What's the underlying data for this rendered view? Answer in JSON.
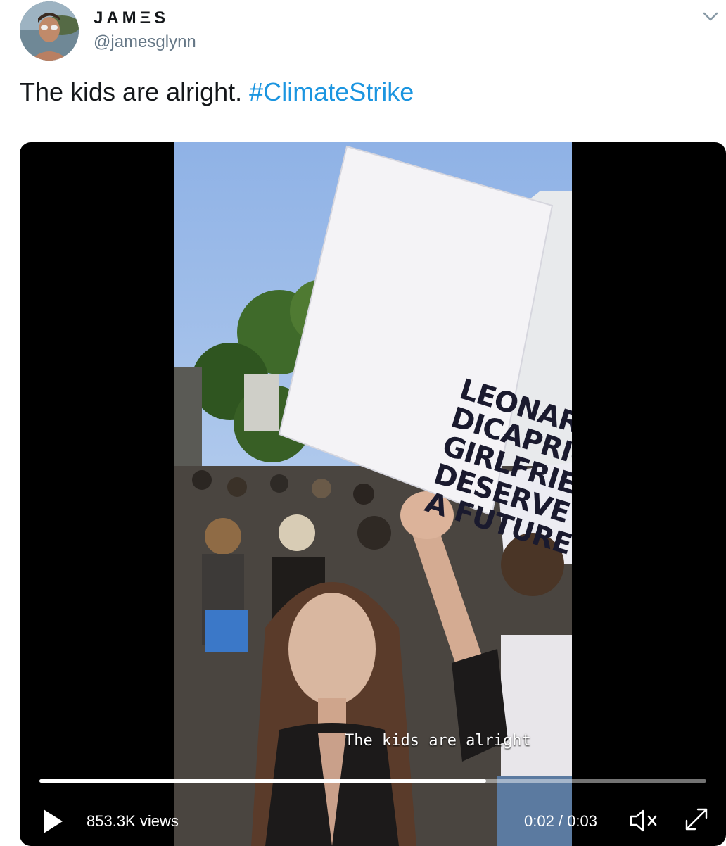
{
  "author": {
    "display_name": "JAMΞS",
    "handle": "@jamesglynn"
  },
  "tweet": {
    "text": "The kids are alright.",
    "hashtag": "#ClimateStrike"
  },
  "video": {
    "sign_lines": [
      "LEONARDO",
      "DICAPRIO'S",
      "GIRLFRIENDS",
      "DESERVE",
      "A FUTURE"
    ],
    "caption": "The kids are alright",
    "views": "853.3K views",
    "time": "0:02 / 0:03",
    "progress_fraction": 0.67
  },
  "colors": {
    "hashtag": "#1b95e0",
    "handle": "#657786",
    "player_bg": "#000000"
  },
  "icons": {
    "caret": "chevron-down-icon",
    "play": "play-icon",
    "mute": "volume-muted-icon",
    "fullscreen": "fullscreen-icon"
  }
}
